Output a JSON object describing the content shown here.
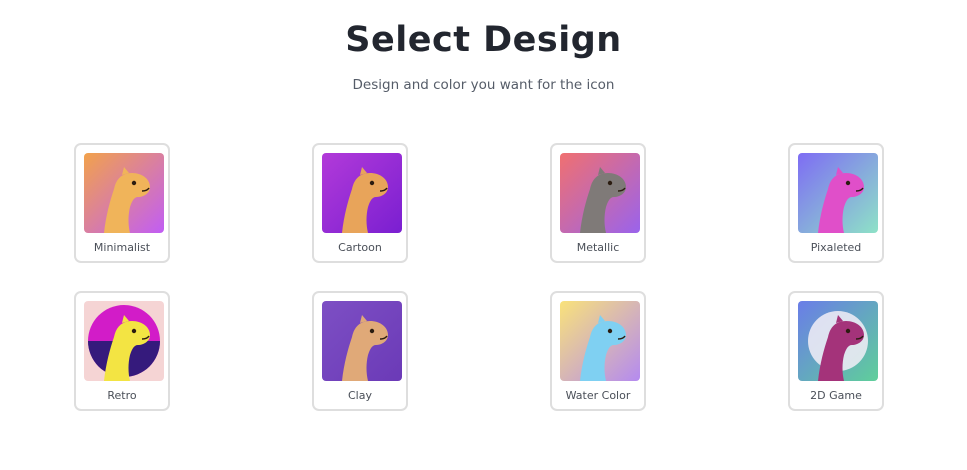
{
  "header": {
    "title": "Select Design",
    "subtitle": "Design and color you want for the icon"
  },
  "designs": [
    {
      "label": "Minimalist",
      "icon": "minimalist-camel-icon",
      "bg": [
        "#f2a24b",
        "#c15df5"
      ],
      "camel": "#f0b45a"
    },
    {
      "label": "Cartoon",
      "icon": "cartoon-camel-icon",
      "bg": [
        "#b23ad9",
        "#7a1fd1"
      ],
      "camel": "#e8a45a"
    },
    {
      "label": "Metallic",
      "icon": "metallic-camel-icon",
      "bg": [
        "#f07070",
        "#9a63ec"
      ],
      "camel": "#7f7a78"
    },
    {
      "label": "Pixaleted",
      "icon": "pixelated-camel-icon",
      "bg": [
        "#7e6cf4",
        "#8ee2c7"
      ],
      "camel": "#e04fc9"
    },
    {
      "label": "Retro",
      "icon": "retro-camel-icon",
      "bg": [
        "#f5d4d4",
        "#f5d4d4"
      ],
      "camel": "#f3e443"
    },
    {
      "label": "Clay",
      "icon": "clay-camel-icon",
      "bg": [
        "#7d4fc4",
        "#6b3ab7"
      ],
      "camel": "#e0a978"
    },
    {
      "label": "Water Color",
      "icon": "watercolor-camel-icon",
      "bg": [
        "#f9e27a",
        "#b48af0"
      ],
      "camel": "#7fd0f2"
    },
    {
      "label": "2D Game",
      "icon": "2d-game-camel-icon",
      "bg": [
        "#6a7de8",
        "#5fcf9a"
      ],
      "camel": "#a4337a"
    }
  ]
}
